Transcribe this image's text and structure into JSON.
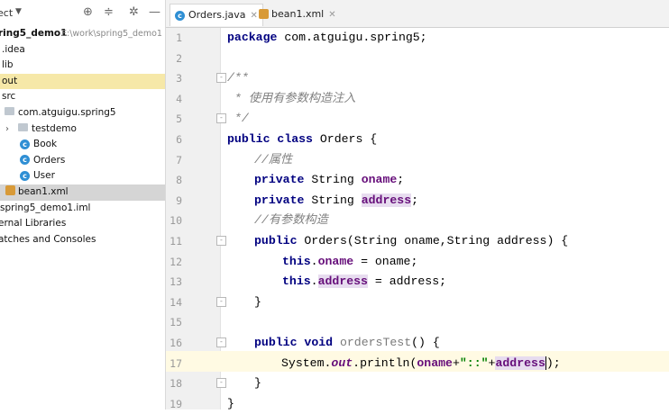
{
  "project_panel": {
    "title": "ect",
    "tree": [
      {
        "label": "ring5_demo1",
        "path": "E:\\work\\spring5_demo1",
        "kind": "module"
      },
      {
        "label": ".idea",
        "kind": "folder"
      },
      {
        "label": "lib",
        "kind": "folder"
      },
      {
        "label": "out",
        "kind": "folder"
      },
      {
        "label": "src",
        "kind": "folder"
      },
      {
        "label": "com.atguigu.spring5",
        "kind": "package"
      },
      {
        "label": "testdemo",
        "kind": "package"
      },
      {
        "label": "Book",
        "kind": "class"
      },
      {
        "label": "Orders",
        "kind": "class"
      },
      {
        "label": "User",
        "kind": "class"
      },
      {
        "label": "bean1.xml",
        "kind": "xml"
      },
      {
        "label": "spring5_demo1.iml",
        "kind": "file"
      },
      {
        "label": "ernal Libraries",
        "kind": "lib"
      },
      {
        "label": "atches and Consoles",
        "kind": "misc"
      }
    ]
  },
  "tabs": [
    {
      "label": "Orders.java",
      "active": true
    },
    {
      "label": "bean1.xml",
      "active": false
    }
  ],
  "editor": {
    "current_line": 17,
    "line_numbers": [
      "1",
      "2",
      "3",
      "4",
      "5",
      "6",
      "7",
      "8",
      "9",
      "10",
      "11",
      "12",
      "13",
      "14",
      "15",
      "16",
      "17",
      "18",
      "19"
    ],
    "code": {
      "l1_kw": "package",
      "l1_rest": " com.atguigu.spring5;",
      "l3": "/**",
      "l4": " * 使用有参数构造注入",
      "l5": " */",
      "l6_kw1": "public",
      "l6_kw2": "class",
      "l6_rest": " Orders {",
      "l7": "//属性",
      "l8_kw": "private",
      "l8_type": " String ",
      "l8_field": "oname",
      "l8_end": ";",
      "l9_kw": "private",
      "l9_type": " String ",
      "l9_field": "address",
      "l9_end": ";",
      "l10": "//有参数构造",
      "l11_kw": "public",
      "l11_rest": " Orders(String oname,String address) {",
      "l12_kw": "this",
      "l12_dot": ".",
      "l12_field": "oname",
      "l12_rest": " = oname;",
      "l13_kw": "this",
      "l13_dot": ".",
      "l13_field": "address",
      "l13_rest": " = address;",
      "l14": "}",
      "l16_kw1": "public",
      "l16_kw2": "void",
      "l16_meth": "ordersTest",
      "l16_rest": "() {",
      "l17_a": "System.",
      "l17_out": "out",
      "l17_b": ".println(",
      "l17_f1": "oname",
      "l17_plus1": "+",
      "l17_str": "\"::\"",
      "l17_plus2": "+",
      "l17_f2": "address",
      "l17_end": ");",
      "l18": "}",
      "l19": "}"
    }
  },
  "colors": {
    "keyword": "#000080",
    "field": "#660e7a",
    "comment": "#808080",
    "string": "#008000",
    "current_line": "#fffae3"
  }
}
